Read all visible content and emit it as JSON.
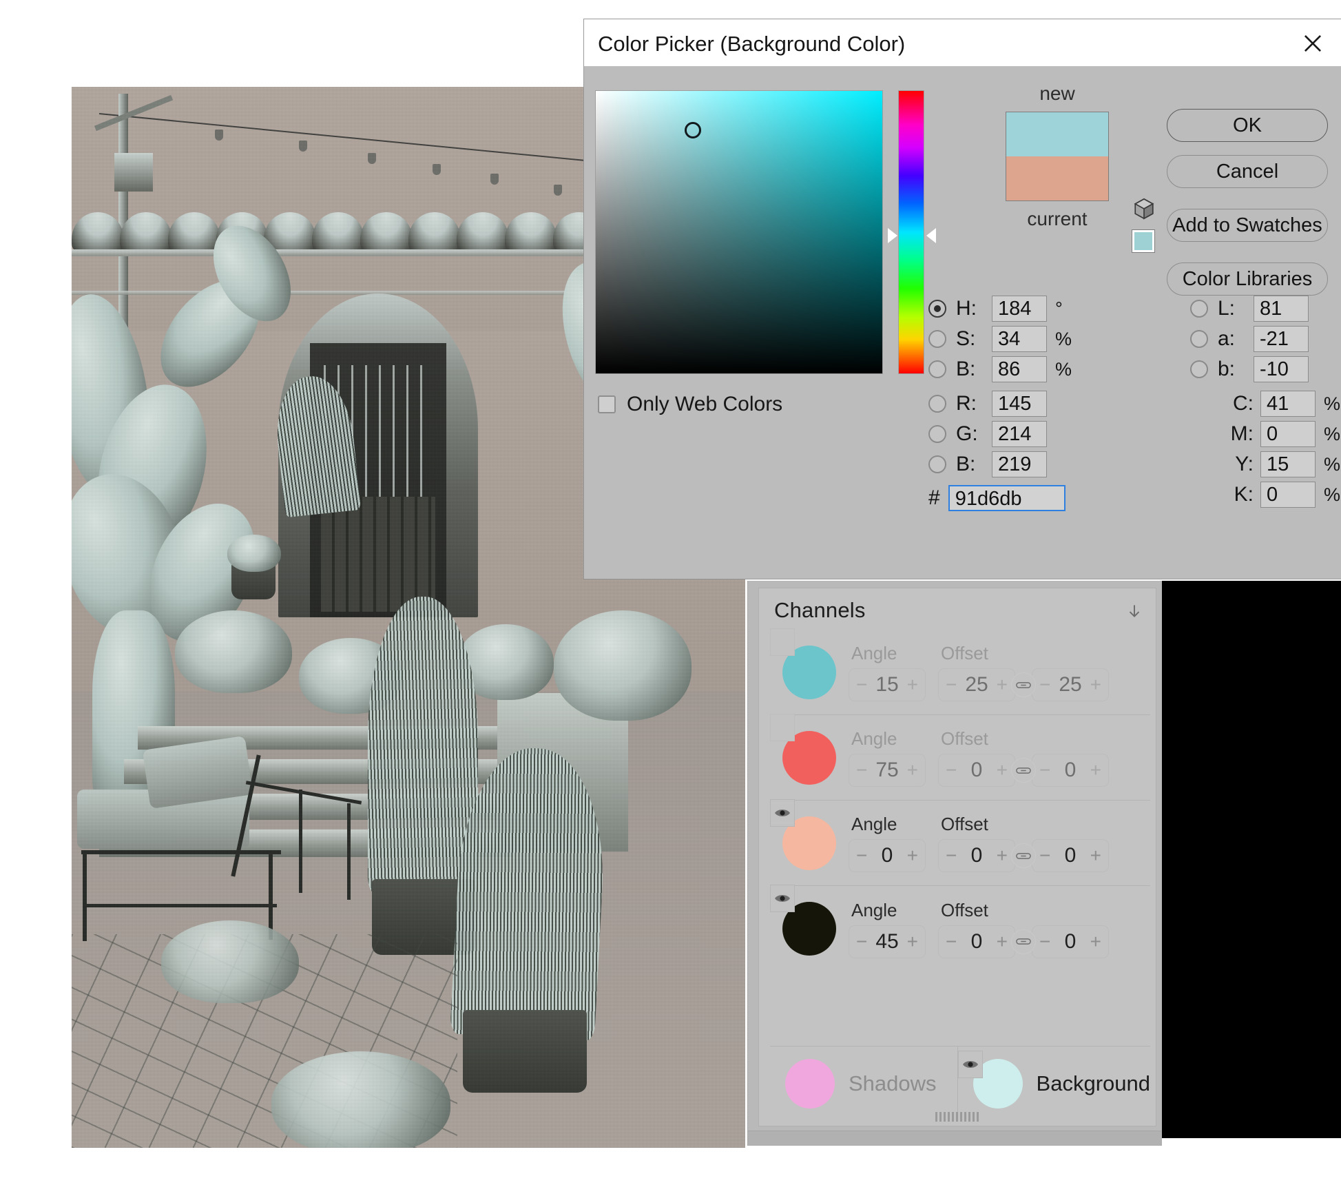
{
  "dialog": {
    "title": "Color Picker (Background Color)",
    "close_icon": "close-icon",
    "buttons": {
      "ok": "OK",
      "cancel": "Cancel",
      "add_to_swatches": "Add to Swatches",
      "color_libraries": "Color Libraries"
    },
    "preview": {
      "new_label": "new",
      "current_label": "current",
      "new_color": "#9ed4d9",
      "current_color": "#dda48e",
      "mini_swatch_color": "#9ed1d4",
      "cube_icon": "cube-icon"
    },
    "only_web_colors": {
      "label": "Only Web Colors",
      "checked": false
    },
    "hsb": [
      {
        "key": "H",
        "label": "H:",
        "value": "184",
        "unit": "°",
        "selected": true
      },
      {
        "key": "S",
        "label": "S:",
        "value": "34",
        "unit": "%",
        "selected": false
      },
      {
        "key": "B",
        "label": "B:",
        "value": "86",
        "unit": "%",
        "selected": false
      }
    ],
    "rgb": [
      {
        "key": "R",
        "label": "R:",
        "value": "145",
        "unit": "",
        "selected": false
      },
      {
        "key": "G",
        "label": "G:",
        "value": "214",
        "unit": "",
        "selected": false
      },
      {
        "key": "B",
        "label": "B:",
        "value": "219",
        "unit": "",
        "selected": false
      }
    ],
    "lab": [
      {
        "key": "L",
        "label": "L:",
        "value": "81",
        "unit": "",
        "selected": false
      },
      {
        "key": "a",
        "label": "a:",
        "value": "-21",
        "unit": "",
        "selected": false
      },
      {
        "key": "b",
        "label": "b:",
        "value": "-10",
        "unit": "",
        "selected": false
      }
    ],
    "cmyk": [
      {
        "key": "C",
        "label": "C:",
        "value": "41",
        "unit": "%"
      },
      {
        "key": "M",
        "label": "M:",
        "value": "0",
        "unit": "%"
      },
      {
        "key": "Y",
        "label": "Y:",
        "value": "15",
        "unit": "%"
      },
      {
        "key": "K",
        "label": "K:",
        "value": "0",
        "unit": "%"
      }
    ],
    "hex": {
      "symbol": "#",
      "value": "91d6db",
      "focused": true
    },
    "hue_angle": 184,
    "sb_marker": {
      "saturation": 34,
      "brightness": 86
    }
  },
  "channels_panel": {
    "title": "Channels",
    "collapse_icon": "chevron-down-icon",
    "angle_label": "Angle",
    "offset_label": "Offset",
    "link_icon": "link-icon",
    "eye_icon": "eye-icon",
    "minus": "−",
    "plus": "+",
    "rows": [
      {
        "color": "#6cc5cb",
        "visible": false,
        "active": false,
        "angle": "15",
        "offset_x": "25",
        "offset_y": "25"
      },
      {
        "color": "#f2605e",
        "visible": false,
        "active": false,
        "angle": "75",
        "offset_x": "0",
        "offset_y": "0"
      },
      {
        "color": "#f5b79f",
        "visible": true,
        "active": true,
        "angle": "0",
        "offset_x": "0",
        "offset_y": "0"
      },
      {
        "color": "#151509",
        "visible": true,
        "active": true,
        "angle": "45",
        "offset_x": "0",
        "offset_y": "0"
      }
    ],
    "footer": [
      {
        "label": "Shadows",
        "color": "#f0a7dd",
        "visible": false,
        "active": false
      },
      {
        "label": "Background",
        "color": "#cdeeec",
        "visible": true,
        "active": true
      }
    ]
  },
  "canvas": {
    "photo_description": "courtyard-photo",
    "black_area": "#000000"
  }
}
